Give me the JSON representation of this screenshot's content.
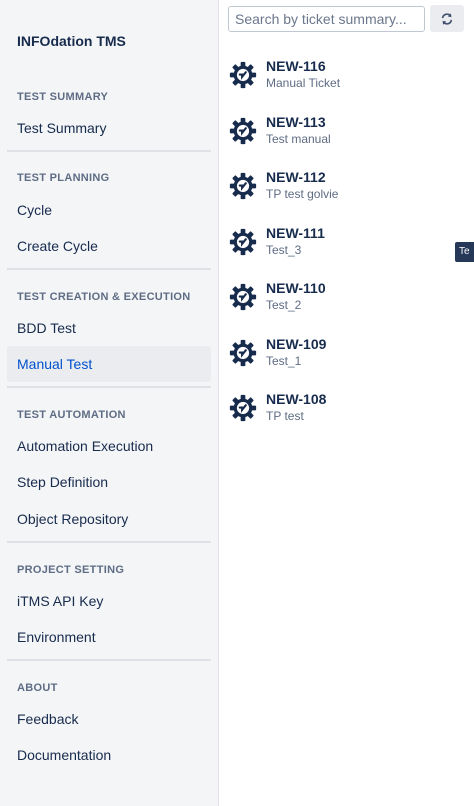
{
  "sidebar": {
    "app_title": "INFOdation TMS",
    "sections": [
      {
        "title": "TEST SUMMARY",
        "items": [
          "Test Summary"
        ]
      },
      {
        "title": "TEST PLANNING",
        "items": [
          "Cycle",
          "Create Cycle"
        ]
      },
      {
        "title": "TEST CREATION & EXECUTION",
        "items": [
          "BDD Test",
          "Manual Test"
        ]
      },
      {
        "title": "TEST AUTOMATION",
        "items": [
          "Automation Execution",
          "Step Definition",
          "Object Repository"
        ]
      },
      {
        "title": "PROJECT SETTING",
        "items": [
          "iTMS API Key",
          "Environment"
        ]
      },
      {
        "title": "ABOUT",
        "items": [
          "Feedback",
          "Documentation"
        ]
      }
    ],
    "active_item": "Manual Test"
  },
  "search": {
    "placeholder": "Search by ticket summary...",
    "value": ""
  },
  "refresh_icon": "refresh-icon",
  "ticket_icon": "gear-icon",
  "tickets": [
    {
      "key": "NEW-116",
      "summary": "Manual Ticket"
    },
    {
      "key": "NEW-113",
      "summary": "Test manual"
    },
    {
      "key": "NEW-112",
      "summary": "TP test golvie"
    },
    {
      "key": "NEW-111",
      "summary": "Test_3"
    },
    {
      "key": "NEW-110",
      "summary": "Test_2"
    },
    {
      "key": "NEW-109",
      "summary": "Test_1"
    },
    {
      "key": "NEW-108",
      "summary": "TP test"
    }
  ],
  "edge_tab": {
    "label": "Te"
  },
  "colors": {
    "accent": "#0052cc",
    "text": "#172b4d",
    "muted": "#5e6c84",
    "sidebar_bg": "#f4f5f7"
  }
}
